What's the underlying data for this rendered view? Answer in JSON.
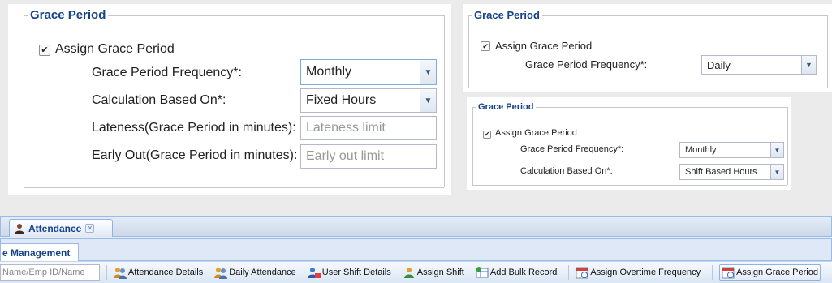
{
  "panel_a": {
    "legend": "Grace Period",
    "assign_label": "Assign Grace Period",
    "frequency_label": "Grace Period Frequency*:",
    "frequency_value": "Monthly",
    "calc_label": "Calculation Based On*:",
    "calc_value": "Fixed Hours",
    "lateness_label": "Lateness(Grace Period in minutes):",
    "lateness_placeholder": "Lateness limit",
    "early_label": "Early Out(Grace Period in minutes):",
    "early_placeholder": "Early out limit"
  },
  "panel_b": {
    "legend": "Grace Period",
    "assign_label": "Assign Grace Period",
    "frequency_label": "Grace Period Frequency*:",
    "frequency_value": "Daily"
  },
  "panel_c": {
    "legend": "Grace Period",
    "assign_label": "Assign Grace Period",
    "frequency_label": "Grace Period Frequency*:",
    "frequency_value": "Monthly",
    "calc_label": "Calculation Based On*:",
    "calc_value": "Shift Based Hours"
  },
  "attendance": {
    "tab_label": "Attendance",
    "subtab_label": "e Management",
    "search_text": "Name/Emp ID/Name",
    "toolbar": [
      {
        "label": "Attendance Details",
        "icon": "users-icon"
      },
      {
        "label": "Daily Attendance",
        "icon": "users-icon"
      },
      {
        "label": "User Shift Details",
        "icon": "user-shift-icon"
      },
      {
        "label": "Assign Shift",
        "icon": "user-icon"
      },
      {
        "label": "Add Bulk Record",
        "icon": "grid-add-icon"
      },
      {
        "label": "Assign Overtime Frequency",
        "icon": "calendar-icon"
      },
      {
        "label": "Assign Grace Period",
        "icon": "calendar-icon"
      }
    ]
  },
  "colors": {
    "legend": "#15428b",
    "border": "#99bbe8",
    "trigger": "#dde6f1"
  }
}
